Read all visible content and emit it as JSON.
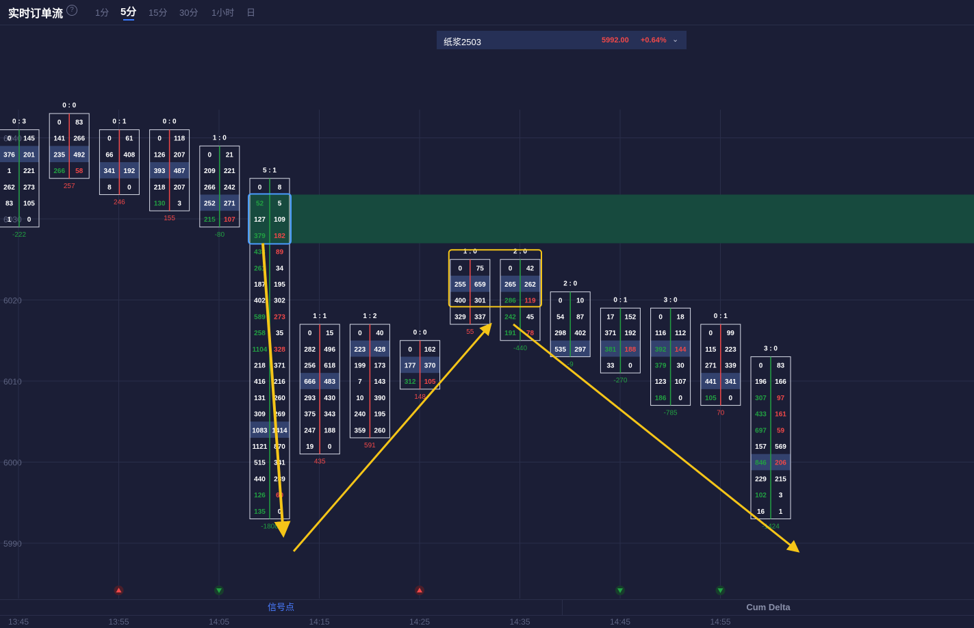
{
  "header": {
    "title": "实时订单流",
    "help_glyph": "?",
    "timeframes": [
      "1分",
      "5分",
      "15分",
      "30分",
      "1小时",
      "日"
    ],
    "active_timeframe": "5分"
  },
  "symbol": {
    "name": "纸浆2503",
    "price": "5992.00",
    "change": "+0.64%"
  },
  "tabs": {
    "signal": "信号点",
    "cum_delta": "Cum Delta"
  },
  "colors": {
    "background": "#1b1e36",
    "up": "#f04848",
    "down": "#22a042",
    "highlight_cell": "#33426e",
    "zone": "#174a3e",
    "arrow": "#f5c518",
    "box_blue": "#4a9cff"
  },
  "chart_data": {
    "type": "footprint",
    "y_ticks": [
      5990,
      6000,
      6010,
      6020,
      6030,
      6040
    ],
    "x_ticks": [
      "13:45",
      "13:55",
      "14:05",
      "14:15",
      "14:25",
      "14:35",
      "14:45",
      "14:55"
    ],
    "zone": {
      "from": 6027,
      "to": 6033
    },
    "candles": [
      {
        "ratio": "0 : 3",
        "top": 6040,
        "rows": [
          [
            "0",
            "145"
          ],
          [
            "376",
            "201"
          ],
          [
            "1",
            "221"
          ],
          [
            "262",
            "273"
          ],
          [
            "83",
            "105"
          ],
          [
            "1",
            "0"
          ]
        ],
        "delta": "-222"
      },
      {
        "ratio": "0 : 0",
        "top": 6042,
        "rows": [
          [
            "0",
            "83"
          ],
          [
            "141",
            "266"
          ],
          [
            "235",
            "492"
          ],
          [
            "266",
            "58"
          ]
        ],
        "delta": "257"
      },
      {
        "ratio": "0 : 1",
        "top": 6040,
        "rows": [
          [
            "0",
            "61"
          ],
          [
            "66",
            "408"
          ],
          [
            "341",
            "192"
          ],
          [
            "8",
            "0"
          ]
        ],
        "delta": "246"
      },
      {
        "ratio": "0 : 0",
        "top": 6040,
        "rows": [
          [
            "0",
            "118"
          ],
          [
            "126",
            "207"
          ],
          [
            "393",
            "487"
          ],
          [
            "218",
            "207"
          ],
          [
            "130",
            "3"
          ]
        ],
        "delta": "155"
      },
      {
        "ratio": "1 : 0",
        "top": 6038,
        "rows": [
          [
            "0",
            "21"
          ],
          [
            "209",
            "221"
          ],
          [
            "266",
            "242"
          ],
          [
            "252",
            "271"
          ],
          [
            "215",
            "107"
          ]
        ],
        "delta": "-80"
      },
      {
        "ratio": "5 : 1",
        "top": 6034,
        "rows": [
          [
            "0",
            "8"
          ],
          [
            "52",
            "5"
          ],
          [
            "127",
            "109"
          ],
          [
            "379",
            "182"
          ],
          [
            "433",
            "89"
          ],
          [
            "261",
            "34"
          ],
          [
            "187",
            "195"
          ],
          [
            "402",
            "302"
          ],
          [
            "589",
            "273"
          ],
          [
            "258",
            "35"
          ],
          [
            "1104",
            "328"
          ],
          [
            "218",
            "371"
          ],
          [
            "416",
            "216"
          ],
          [
            "131",
            "260"
          ],
          [
            "309",
            "269"
          ],
          [
            "1083",
            "1414"
          ],
          [
            "1121",
            "870"
          ],
          [
            "515",
            "341"
          ],
          [
            "440",
            "289"
          ],
          [
            "126",
            "60"
          ],
          [
            "135",
            "0"
          ]
        ],
        "delta": "-1808"
      },
      {
        "ratio": "1 : 1",
        "top": 6016,
        "rows": [
          [
            "0",
            "15"
          ],
          [
            "282",
            "496"
          ],
          [
            "256",
            "618"
          ],
          [
            "666",
            "483"
          ],
          [
            "293",
            "430"
          ],
          [
            "375",
            "343"
          ],
          [
            "247",
            "188"
          ],
          [
            "19",
            "0"
          ]
        ],
        "delta": "435"
      },
      {
        "ratio": "1 : 2",
        "top": 6016,
        "rows": [
          [
            "0",
            "40"
          ],
          [
            "223",
            "428"
          ],
          [
            "199",
            "173"
          ],
          [
            "7",
            "143"
          ],
          [
            "10",
            "390"
          ],
          [
            "240",
            "195"
          ],
          [
            "359",
            "260"
          ]
        ],
        "delta": "591"
      },
      {
        "ratio": "0 : 0",
        "top": 6014,
        "rows": [
          [
            "0",
            "162"
          ],
          [
            "177",
            "370"
          ],
          [
            "312",
            "105"
          ]
        ],
        "delta": "148"
      },
      {
        "ratio": "1 : 0",
        "top": 6024,
        "rows": [
          [
            "0",
            "75"
          ],
          [
            "255",
            "659"
          ],
          [
            "400",
            "301"
          ],
          [
            "329",
            "337"
          ]
        ],
        "delta": "55"
      },
      {
        "ratio": "2 : 0",
        "top": 6024,
        "rows": [
          [
            "0",
            "42"
          ],
          [
            "265",
            "262"
          ],
          [
            "286",
            "119"
          ],
          [
            "242",
            "45"
          ],
          [
            "191",
            "78"
          ]
        ],
        "delta": "-440"
      },
      {
        "ratio": "2 : 0",
        "top": 6020,
        "rows": [
          [
            "0",
            "10"
          ],
          [
            "54",
            "87"
          ],
          [
            "298",
            "402"
          ],
          [
            "535",
            "297"
          ]
        ],
        "delta": "-9"
      },
      {
        "ratio": "0 : 1",
        "top": 6018,
        "rows": [
          [
            "17",
            "152"
          ],
          [
            "371",
            "192"
          ],
          [
            "381",
            "188"
          ],
          [
            "33",
            "0"
          ]
        ],
        "delta": "-270"
      },
      {
        "ratio": "3 : 0",
        "top": 6018,
        "rows": [
          [
            "0",
            "18"
          ],
          [
            "116",
            "112"
          ],
          [
            "392",
            "144"
          ],
          [
            "379",
            "30"
          ],
          [
            "123",
            "107"
          ],
          [
            "186",
            "0"
          ]
        ],
        "delta": "-785"
      },
      {
        "ratio": "0 : 1",
        "top": 6016,
        "rows": [
          [
            "0",
            "99"
          ],
          [
            "115",
            "223"
          ],
          [
            "271",
            "339"
          ],
          [
            "441",
            "341"
          ],
          [
            "105",
            "0"
          ]
        ],
        "delta": "70"
      },
      {
        "ratio": "3 : 0",
        "top": 6012,
        "rows": [
          [
            "0",
            "83"
          ],
          [
            "196",
            "166"
          ],
          [
            "307",
            "97"
          ],
          [
            "433",
            "161"
          ],
          [
            "697",
            "59"
          ],
          [
            "157",
            "569"
          ],
          [
            "846",
            "206"
          ],
          [
            "229",
            "215"
          ],
          [
            "102",
            "3"
          ],
          [
            "16",
            "1"
          ]
        ],
        "delta": "-1424"
      }
    ],
    "signals": [
      {
        "time": "13:55",
        "kind": "up"
      },
      {
        "time": "14:05",
        "kind": "down-strong"
      },
      {
        "time": "14:25",
        "kind": "up"
      },
      {
        "time": "14:45",
        "kind": "down"
      },
      {
        "time": "14:55",
        "kind": "down-strong"
      }
    ]
  }
}
